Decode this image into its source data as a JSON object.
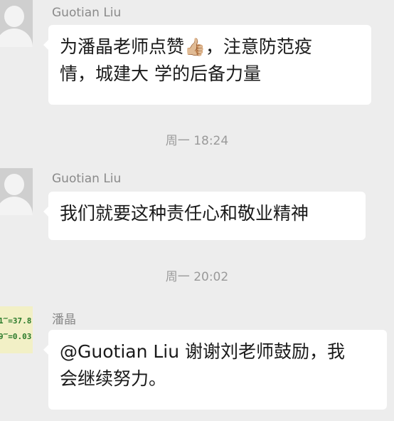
{
  "messages": [
    {
      "sender": "Guotian Liu",
      "line1_before": "为潘晶老师点赞",
      "line1_emoji": "👍🏼",
      "line1_after": "，注意防范疫",
      "line2": "情，城建大 学的后备力量"
    },
    {
      "sender": "Guotian Liu",
      "line1": "我们就要这种责任心和敬业精神"
    },
    {
      "sender": "潘晶",
      "line1": "@Guotian Liu  谢谢刘老师鼓励，我",
      "line2": "会继续努力。",
      "avatar_text": [
        "1‴=37.8",
        "9‴=0.03"
      ]
    }
  ],
  "timestamps": [
    "周一 18:24",
    "周一 20:02"
  ]
}
